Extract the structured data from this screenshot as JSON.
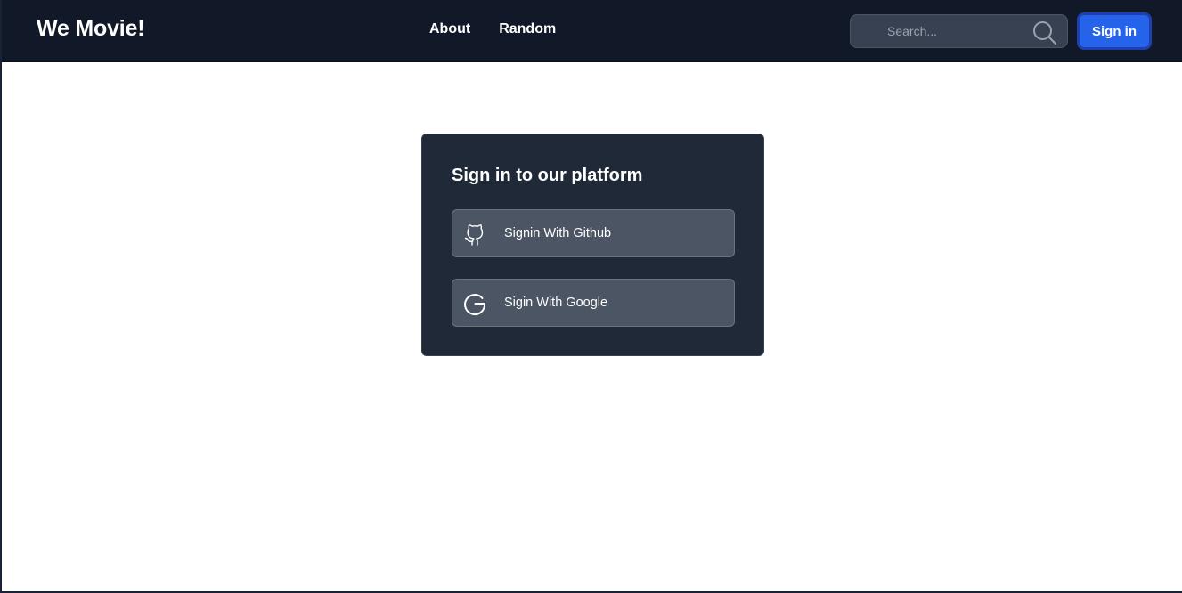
{
  "navbar": {
    "brand": "We Movie!",
    "links": [
      "About",
      "Random"
    ],
    "search": {
      "placeholder": "Search...",
      "icon": "search-icon"
    },
    "signin_label": "Sign in"
  },
  "login_card": {
    "title": "Sign in to our platform",
    "providers": [
      {
        "label": "Signin With Github",
        "icon": "github-icon"
      },
      {
        "label": "Sigin With Google",
        "icon": "google-icon"
      }
    ]
  },
  "colors": {
    "navbar_bg": "#111827",
    "card_bg": "#1f2937",
    "button_bg": "#4b5563",
    "accent": "#2563eb"
  }
}
